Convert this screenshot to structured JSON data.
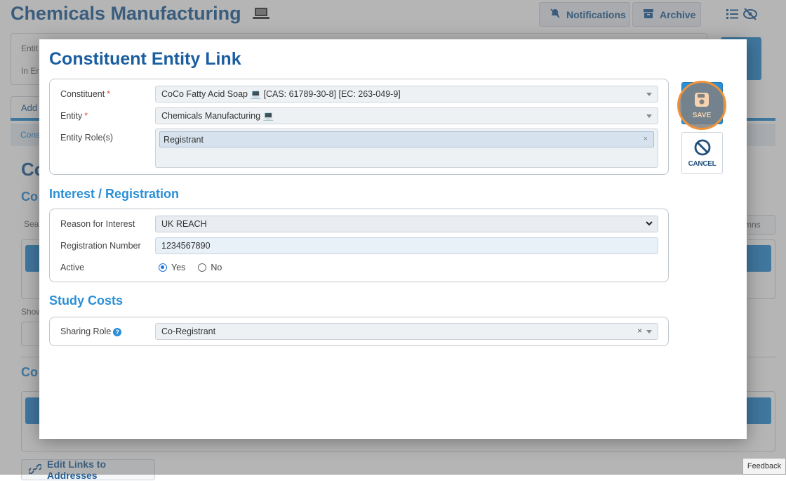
{
  "background": {
    "title": "Chemicals Manufacturing",
    "notifications_label": "Notifications",
    "archive_label": "Archive",
    "entity_label_partial": "Entit",
    "in_entity_partial": "In En",
    "tab_partial": "Add",
    "breadcrumb_partial": "Cons",
    "heading_partial_1": "Co",
    "heading_partial_2": "Co",
    "heading_partial_3": "Co",
    "search_partial": "Sea",
    "show_partial": "Show",
    "columns_partial": "mns",
    "edit_links_label": "Edit Links to Addresses",
    "feedback_label": "Feedback"
  },
  "modal": {
    "title": "Constituent Entity Link",
    "constituent": {
      "label": "Constituent",
      "value": "CoCo Fatty Acid Soap 💻 [CAS: 61789-30-8] [EC: 263-049-9]"
    },
    "entity": {
      "label": "Entity",
      "value": "Chemicals Manufacturing 💻"
    },
    "entity_roles": {
      "label": "Entity Role(s)",
      "tags": [
        "Registrant"
      ]
    },
    "interest_section_title": "Interest / Registration",
    "reason_for_interest": {
      "label": "Reason for Interest",
      "value": "UK REACH"
    },
    "registration_number": {
      "label": "Registration Number",
      "value": "1234567890"
    },
    "active": {
      "label": "Active",
      "options": [
        "Yes",
        "No"
      ],
      "selected": "Yes"
    },
    "study_costs_section_title": "Study Costs",
    "sharing_role": {
      "label": "Sharing Role",
      "value": "Co-Registrant"
    },
    "save_label": "SAVE",
    "cancel_label": "CANCEL"
  },
  "colors": {
    "brand_blue": "#1f5f99",
    "accent_blue": "#2a8fd6",
    "required_red": "#d9534f",
    "highlight_orange": "#f0923a"
  }
}
